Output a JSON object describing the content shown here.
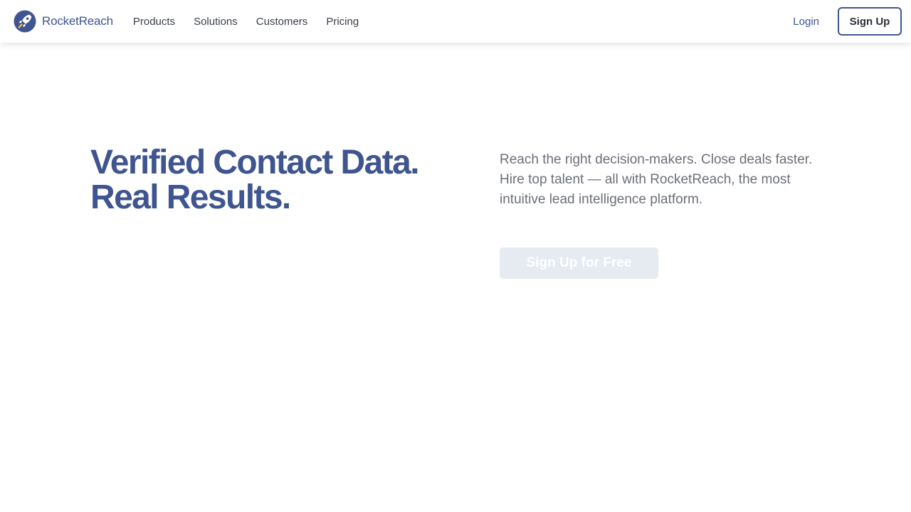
{
  "brand": {
    "name": "RocketReach",
    "logo_icon": "rocket-icon"
  },
  "nav": {
    "items": [
      {
        "label": "Products"
      },
      {
        "label": "Solutions"
      },
      {
        "label": "Customers"
      },
      {
        "label": "Pricing"
      }
    ],
    "login_label": "Login",
    "signup_label": "Sign Up"
  },
  "hero": {
    "title_line_1": "Verified Contact Data.",
    "title_line_2": "Real Results.",
    "description": "Reach the right decision-makers. Close deals faster. Hire top talent — all with RocketReach, the most intuitive lead intelligence platform.",
    "cta_label": "Sign Up for Free"
  },
  "colors": {
    "brand_blue": "#3f5590",
    "body_text": "#6b6f78",
    "cta_background": "#e6eaf1",
    "rocket_accent": "#f2b33d"
  }
}
